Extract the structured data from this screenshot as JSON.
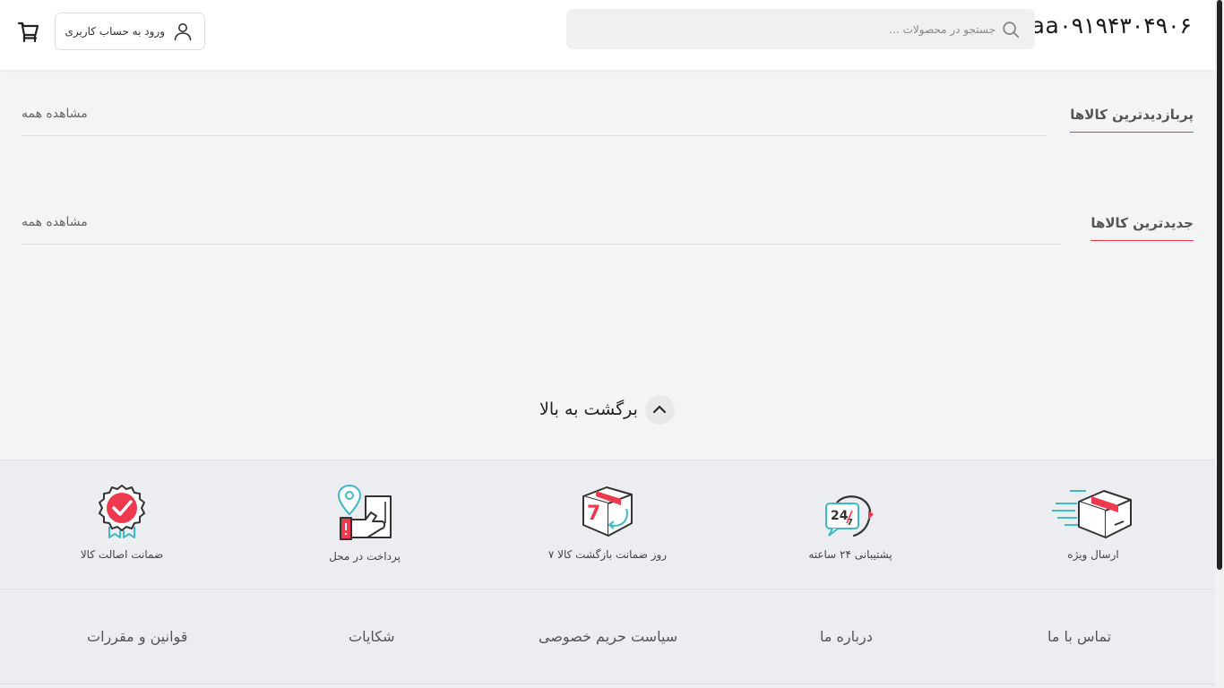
{
  "header": {
    "logo_text": "aa۰۹۱۹۴۳۰۴۹۰۶",
    "search_placeholder": "جستجو در محصولات ...",
    "login_label": "ورود به حساب کاربری"
  },
  "sections": [
    {
      "title": "پربازدیدترین کالاها",
      "see_all": "مشاهده همه"
    },
    {
      "title": "جدیدترین کالاها",
      "see_all": "مشاهده همه"
    }
  ],
  "back_to_top": "برگشت به بالا",
  "features": [
    {
      "icon": "fast-delivery-icon",
      "label": "ارسال ویژه"
    },
    {
      "icon": "support-247-icon",
      "label": "پشتیبانی ۲۴ ساعته"
    },
    {
      "icon": "seven-day-return-icon",
      "label": "۷ روز ضمانت بازگشت کالا"
    },
    {
      "icon": "cash-on-delivery-icon",
      "label": "پرداخت در محل"
    },
    {
      "icon": "authenticity-badge-icon",
      "label": "ضمانت اصالت کالا"
    }
  ],
  "footer_links": [
    "تماس با ما",
    "درباره ما",
    "سیاست حریم خصوصی",
    "شکایات",
    "قوانین و مقررات"
  ],
  "colors": {
    "accent": "#ef394e",
    "teal": "#3fb8c8",
    "dark": "#333333"
  }
}
